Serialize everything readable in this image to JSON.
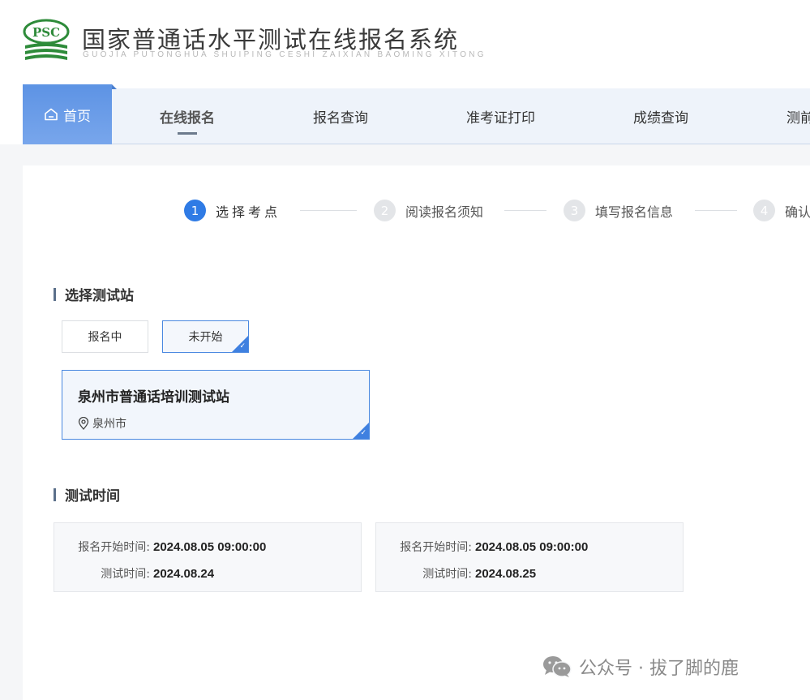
{
  "header": {
    "title": "国家普通话水平测试在线报名系统",
    "subtitle": "GUOJIA PUTONGHUA SHUIPING CESHI ZAIXIAN BAOMING XITONG",
    "logo_text": "PSC"
  },
  "nav": {
    "home": "首页",
    "items": [
      {
        "label": "在线报名",
        "active": true
      },
      {
        "label": "报名查询",
        "active": false
      },
      {
        "label": "准考证打印",
        "active": false
      },
      {
        "label": "成绩查询",
        "active": false
      },
      {
        "label": "测前",
        "active": false
      }
    ]
  },
  "steps": [
    {
      "num": "1",
      "label": "选择考点",
      "active": true
    },
    {
      "num": "2",
      "label": "阅读报名须知",
      "active": false
    },
    {
      "num": "3",
      "label": "填写报名信息",
      "active": false
    },
    {
      "num": "4",
      "label": "确认",
      "active": false
    }
  ],
  "station_section": {
    "title": "选择测试站",
    "filters": [
      {
        "label": "报名中",
        "selected": false
      },
      {
        "label": "未开始",
        "selected": true
      }
    ],
    "station": {
      "name": "泉州市普通话培训测试站",
      "city": "泉州市"
    }
  },
  "time_section": {
    "title": "测试时间",
    "cards": [
      {
        "start_label": "报名开始时间:",
        "start_value": "2024.08.05 09:00:00",
        "test_label": "测试时间:",
        "test_value": "2024.08.24"
      },
      {
        "start_label": "报名开始时间:",
        "start_value": "2024.08.05 09:00:00",
        "test_label": "测试时间:",
        "test_value": "2024.08.25"
      }
    ]
  },
  "watermark": {
    "text": "公众号 · 拔了脚的鹿"
  },
  "colors": {
    "primary": "#2f7be5",
    "nav_bg": "#eef3fa",
    "logo_green": "#2e8b3a"
  }
}
